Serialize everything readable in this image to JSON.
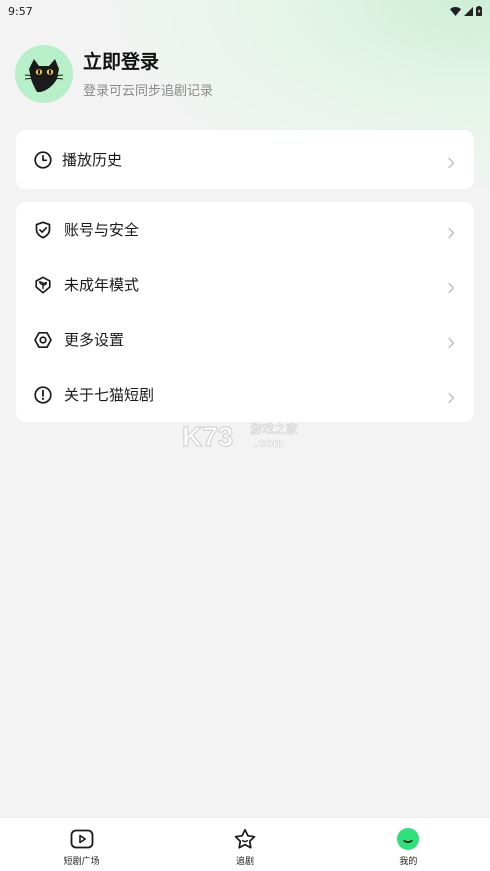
{
  "status_bar": {
    "time": "9:57"
  },
  "profile": {
    "title": "立即登录",
    "subtitle": "登录可云同步追剧记录"
  },
  "history": {
    "label": "播放历史",
    "icon": "clock-icon"
  },
  "settings": [
    {
      "label": "账号与安全",
      "icon": "shield-check-icon"
    },
    {
      "label": "未成年模式",
      "icon": "sprout-shield-icon"
    },
    {
      "label": "更多设置",
      "icon": "settings-hex-icon"
    },
    {
      "label": "关于七猫短剧",
      "icon": "info-alert-icon"
    }
  ],
  "watermark": {
    "brand": "K73",
    "cn": "游戏之家",
    "domain": ".com"
  },
  "bottom_nav": [
    {
      "label": "短剧广场",
      "icon": "play-square-icon"
    },
    {
      "label": "追剧",
      "icon": "star-icon"
    },
    {
      "label": "我的",
      "icon": "profile-face-icon"
    }
  ],
  "colors": {
    "accent_green": "#2ee07a",
    "avatar_bg": "#b7efc9"
  }
}
